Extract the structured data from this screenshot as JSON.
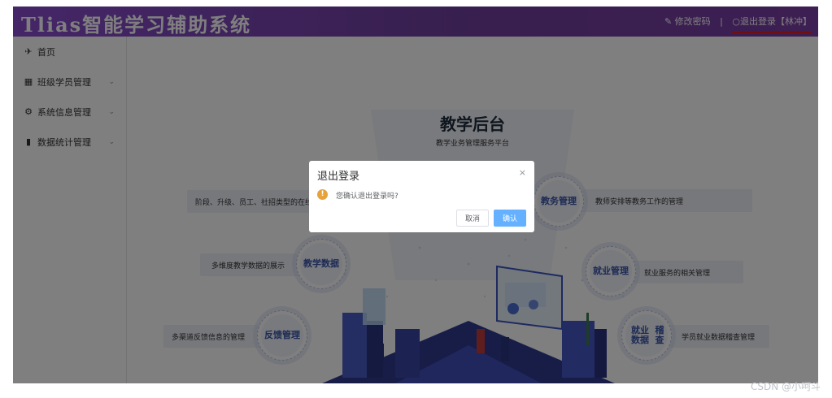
{
  "header": {
    "title": "Tlias智能学习辅助系统",
    "edit_password": "修改密码",
    "separator": "|",
    "logout": "退出登录【林冲】"
  },
  "sidebar": {
    "items": [
      {
        "label": "首页",
        "icon": "send-icon",
        "glyph": "✈",
        "has_children": false
      },
      {
        "label": "班级学员管理",
        "icon": "grid-icon",
        "glyph": "▦",
        "has_children": true
      },
      {
        "label": "系统信息管理",
        "icon": "gear-icon",
        "glyph": "⚙",
        "has_children": true
      },
      {
        "label": "数据统计管理",
        "icon": "bar-chart-icon",
        "glyph": "▮",
        "has_children": true
      }
    ],
    "chevron": "⌄"
  },
  "main": {
    "hero_title": "教学后台",
    "hero_subtitle": "教学业务管理服务平台",
    "features": {
      "left_top_text": "阶段、升级、员工、社招类型的在线",
      "left_mid_text": "多维度教学数据的展示",
      "left_mid_label": "教学数据",
      "left_bot_text": "多渠道反馈信息的管理",
      "left_bot_label": "反馈管理",
      "right_top_label": "教务管理",
      "right_top_text": "教师安排等教务工作的管理",
      "right_mid_label": "就业管理",
      "right_mid_text": "就业服务的相关管理",
      "right_bot_label_1": "就业数据",
      "right_bot_label_2": "稽查",
      "right_bot_text": "学员就业数据稽查管理"
    }
  },
  "dialog": {
    "title": "退出登录",
    "close": "×",
    "warn_glyph": "!",
    "message": "您确认退出登录吗?",
    "cancel_label": "取消",
    "ok_label": "确认"
  },
  "watermark": "CSDN @小呵斗",
  "colors": {
    "header_start": "#8a4dd0",
    "header_end": "#7b3fa6",
    "primary": "#66b1ff",
    "warning": "#e6a23c",
    "underline": "#e01e1e"
  }
}
